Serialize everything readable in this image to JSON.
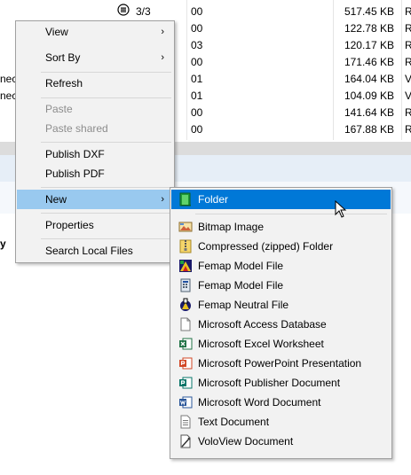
{
  "file_list": {
    "status_value": "3/3",
    "rows": [
      {
        "left": "",
        "version": "00",
        "size": "517.45 KB",
        "type": "R"
      },
      {
        "left": "",
        "version": "00",
        "size": "122.78 KB",
        "type": "R"
      },
      {
        "left": "",
        "version": "03",
        "size": "120.17 KB",
        "type": "R"
      },
      {
        "left": "",
        "version": "00",
        "size": "171.46 KB",
        "type": "R"
      },
      {
        "left": "nec",
        "version": "01",
        "size": "164.04 KB",
        "type": "V"
      },
      {
        "left": "nec",
        "version": "01",
        "size": "104.09 KB",
        "type": "V"
      },
      {
        "left": "",
        "version": "00",
        "size": "141.64 KB",
        "type": "R"
      },
      {
        "left": "",
        "version": "00",
        "size": "167.88 KB",
        "type": "R"
      }
    ],
    "partial_label": "y"
  },
  "context_menu": {
    "items": [
      {
        "label": "View",
        "submenu": true,
        "disabled": false
      },
      {
        "label": "Sort By",
        "submenu": true,
        "disabled": false
      },
      {
        "label": "Refresh",
        "submenu": false,
        "disabled": false
      },
      {
        "label": "Paste",
        "submenu": false,
        "disabled": true
      },
      {
        "label": "Paste shared",
        "submenu": false,
        "disabled": true
      },
      {
        "label": "Publish DXF",
        "submenu": false,
        "disabled": false
      },
      {
        "label": "Publish PDF",
        "submenu": false,
        "disabled": false
      },
      {
        "label": "New",
        "submenu": true,
        "disabled": false,
        "highlighted": true
      },
      {
        "label": "Properties",
        "submenu": false,
        "disabled": false
      },
      {
        "label": "Search Local Files",
        "submenu": false,
        "disabled": false
      }
    ],
    "arrow_glyph": "›"
  },
  "new_submenu": {
    "items": [
      {
        "label": "Folder",
        "icon": "folder-icon",
        "selected": true
      },
      {
        "label": "Bitmap Image",
        "icon": "bitmap-image-icon"
      },
      {
        "label": "Compressed (zipped) Folder",
        "icon": "zip-folder-icon"
      },
      {
        "label": "Femap Model File",
        "icon": "femap-model-icon"
      },
      {
        "label": "Femap Model File",
        "icon": "femap-model-alt-icon"
      },
      {
        "label": "Femap Neutral File",
        "icon": "femap-neutral-icon"
      },
      {
        "label": "Microsoft Access Database",
        "icon": "blank-document-icon"
      },
      {
        "label": "Microsoft Excel Worksheet",
        "icon": "excel-icon"
      },
      {
        "label": "Microsoft PowerPoint Presentation",
        "icon": "powerpoint-icon"
      },
      {
        "label": "Microsoft Publisher Document",
        "icon": "publisher-icon"
      },
      {
        "label": "Microsoft Word Document",
        "icon": "word-icon"
      },
      {
        "label": "Text Document",
        "icon": "text-document-icon"
      },
      {
        "label": "VoloView Document",
        "icon": "voloview-icon"
      }
    ]
  },
  "colors": {
    "menu_bg": "#f2f2f2",
    "menu_highlight": "#99c9ef",
    "submenu_selected": "#0078d7"
  }
}
